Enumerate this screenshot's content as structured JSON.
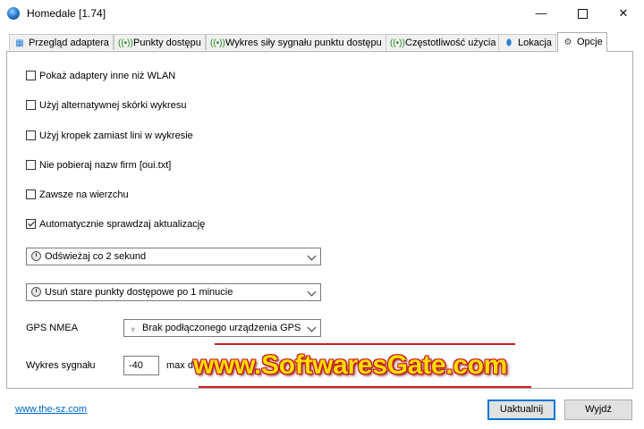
{
  "window": {
    "title": "Homedale [1.74]",
    "controls": {
      "minimize": "—",
      "close": "✕"
    }
  },
  "tabs": [
    {
      "label": "Przegląd adaptera",
      "icon": "adapter-icon",
      "active": false
    },
    {
      "label": "Punkty dostępu",
      "icon": "wifi-signal-icon",
      "active": false
    },
    {
      "label": "Wykres siły sygnału punktu dostępu",
      "icon": "wifi-signal-icon",
      "active": false
    },
    {
      "label": "Częstotliwość użycia",
      "icon": "wifi-signal-icon",
      "active": false
    },
    {
      "label": "Lokacja",
      "icon": "location-pin-icon",
      "active": false
    },
    {
      "label": "Opcje",
      "icon": "settings-icon",
      "active": true
    }
  ],
  "options": {
    "checkboxes": [
      {
        "label": "Pokaż adaptery inne niż WLAN",
        "checked": false
      },
      {
        "label": "Użyj alternatywnej skórki wykresu",
        "checked": false
      },
      {
        "label": "Użyj kropek zamiast lini w wykresie",
        "checked": false
      },
      {
        "label": "Nie pobieraj nazw firm [oui.txt]",
        "checked": false
      },
      {
        "label": "Zawsze na wierzchu",
        "checked": false
      },
      {
        "label": "Automatycznie sprawdzaj aktualizację",
        "checked": true
      }
    ],
    "refresh_select": "Odświeżaj co 2 sekund",
    "remove_select": "Usuń stare punkty dostępowe po 1 minucie",
    "gps_label": "GPS NMEA",
    "gps_select": "Brak podłączonego urządzenia GPS",
    "signal_label": "Wykres sygnału",
    "signal_value": "-40",
    "signal_suffix": "max dB"
  },
  "watermark": "www.SoftwaresGate.com",
  "footer": {
    "link": "www.the-sz.com",
    "update_button": "Uaktualnij",
    "exit_button": "Wyjdź"
  },
  "colors": {
    "accent": "#0078d7",
    "link": "#0066cc",
    "watermark_fill": "#ffdc00",
    "watermark_outline": "#c4141b"
  }
}
